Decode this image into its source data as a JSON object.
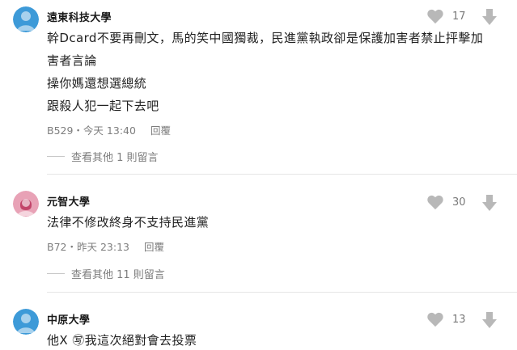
{
  "comments": [
    {
      "school": "遠東科技大學",
      "likes": "17",
      "lines": [
        "幹Dcard不要再刪文，馬的笑中國獨裁，民進黨執政卻是保護加害者禁止抨擊加",
        "害者言論",
        "操你媽還想選總統",
        "跟殺人犯一起下去吧"
      ],
      "floor_time": "B529・今天 13:40",
      "reply_label": "回覆",
      "more_replies": "查看其他 1 則留言",
      "avatar_color": "#3d9ad8",
      "avatar_icon": "male-avatar-icon"
    },
    {
      "school": "元智大學",
      "likes": "30",
      "lines": [
        "法律不修改終身不支持民進黨"
      ],
      "floor_time": "B72・昨天 23:13",
      "reply_label": "回覆",
      "more_replies": "查看其他 11 則留言",
      "avatar_color": "#e8a2b6",
      "avatar_icon": "female-avatar-icon"
    },
    {
      "school": "中原大學",
      "likes": "13",
      "lines": [
        "他X ㊢我這次絕對會去投票"
      ],
      "avatar_color": "#3d9ad8",
      "avatar_icon": "male-avatar-icon"
    }
  ],
  "colors": {
    "icon_gray": "#b8b8b8",
    "meta_gray": "#7d7d7d",
    "divider": "#e6e6e6"
  }
}
